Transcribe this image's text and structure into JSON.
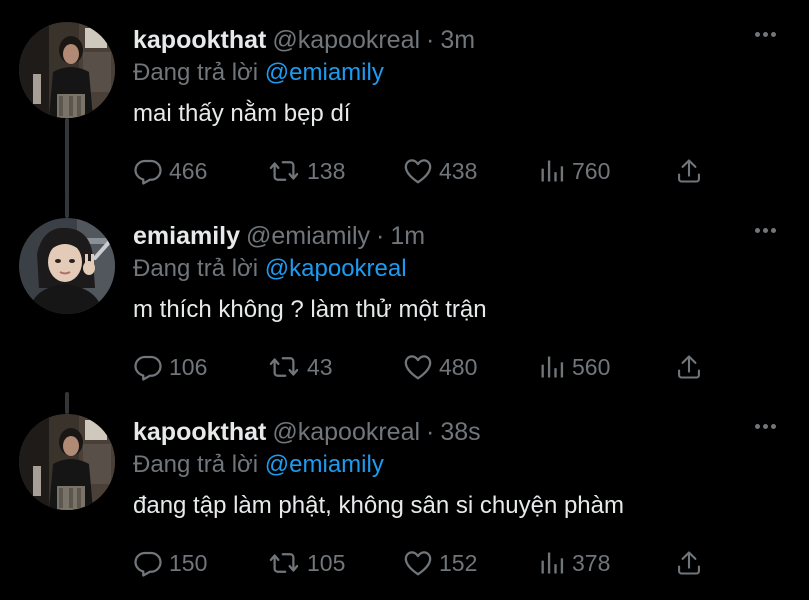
{
  "colors": {
    "background": "#000000",
    "text_primary": "#e7e9ea",
    "text_secondary": "#71767b",
    "mention": "#1d9bf0",
    "thread_line": "#333639"
  },
  "icons": {
    "reply": "speech-bubble-icon",
    "retweet": "retweet-arrows-icon",
    "like": "heart-icon",
    "views": "bar-chart-icon",
    "share": "share-upload-icon",
    "more": "three-dots-icon"
  },
  "tweets": [
    {
      "display_name": "kapookthat",
      "handle": "@kapookreal",
      "separator": "·",
      "time": "3m",
      "reply_prefix": "Đang trả lời",
      "reply_to": "@emiamily",
      "text": "mai thấy nằm bẹp dí",
      "replies": "466",
      "retweets": "138",
      "likes": "438",
      "views": "760"
    },
    {
      "display_name": "emiamily",
      "handle": "@emiamily",
      "separator": "·",
      "time": "1m",
      "reply_prefix": "Đang trả lời",
      "reply_to": "@kapookreal",
      "text": "m thích không ? làm thử một trận",
      "replies": "106",
      "retweets": "43",
      "likes": "480",
      "views": "560"
    },
    {
      "display_name": "kapookthat",
      "handle": "@kapookreal",
      "separator": "·",
      "time": "38s",
      "reply_prefix": "Đang trả lời",
      "reply_to": "@emiamily",
      "text": "đang tập làm phật, không sân si chuyện phàm",
      "replies": "150",
      "retweets": "105",
      "likes": "152",
      "views": "378"
    }
  ]
}
